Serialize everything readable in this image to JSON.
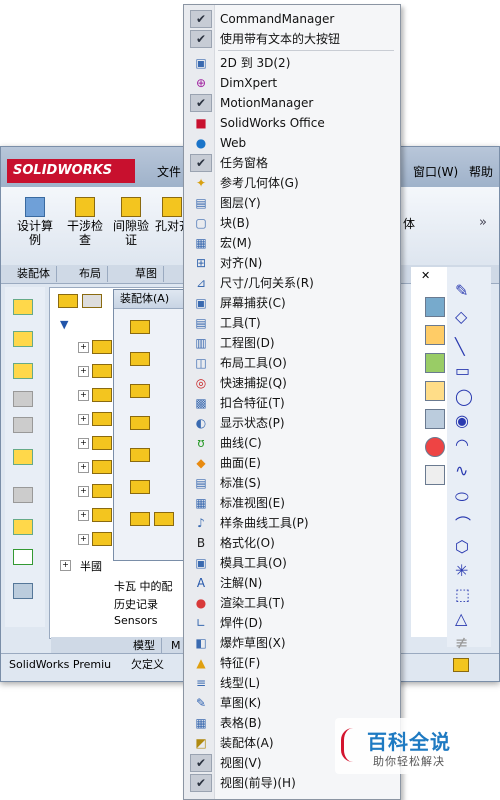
{
  "app": {
    "logo": "SOLIDWORKS",
    "menubar": [
      {
        "label": "文件"
      },
      {
        "label": "窗口(W)"
      },
      {
        "label": "帮助"
      }
    ],
    "ribbon": [
      {
        "label": "设计算\n例"
      },
      {
        "label": "干涉检\n查"
      },
      {
        "label": "间隙验\n证"
      },
      {
        "label": "孔对齐"
      },
      {
        "label": "体"
      }
    ],
    "tabs": [
      {
        "label": "装配体"
      },
      {
        "label": "布局"
      },
      {
        "label": "草图"
      }
    ],
    "popup_title": "装配体(A)",
    "tree": [
      {
        "label": "半國"
      },
      {
        "label": "卡瓦 中的配"
      },
      {
        "label": "历史记录"
      },
      {
        "label": "Sensors"
      }
    ],
    "bottom_tabs": [
      {
        "label": "模型"
      },
      {
        "label": "M"
      }
    ],
    "status_left": "SolidWorks Premiu",
    "status_mid": "欠定义"
  },
  "menu": {
    "items": [
      {
        "label": "CommandManager",
        "checked": true,
        "icon": "check-icon"
      },
      {
        "label": "使用带有文本的大按钮",
        "checked": true,
        "icon": "check-icon"
      },
      {
        "label": "2D 到 3D(2)",
        "checked": false,
        "icon": "2d-to-3d-icon"
      },
      {
        "label": "DimXpert",
        "checked": false,
        "icon": "dimxpert-icon"
      },
      {
        "label": "MotionManager",
        "checked": true,
        "icon": "check-icon"
      },
      {
        "label": "SolidWorks Office",
        "checked": false,
        "icon": "sw-office-icon"
      },
      {
        "label": "Web",
        "checked": false,
        "icon": "globe-icon"
      },
      {
        "label": "任务窗格",
        "checked": true,
        "icon": "check-icon"
      },
      {
        "label": "参考几何体(G)",
        "checked": false,
        "icon": "reference-geometry-icon"
      },
      {
        "label": "图层(Y)",
        "checked": false,
        "icon": "layer-icon"
      },
      {
        "label": "块(B)",
        "checked": false,
        "icon": "block-icon"
      },
      {
        "label": "宏(M)",
        "checked": false,
        "icon": "macro-icon"
      },
      {
        "label": "对齐(N)",
        "checked": false,
        "icon": "align-icon"
      },
      {
        "label": "尺寸/几何关系(R)",
        "checked": false,
        "icon": "dimension-icon"
      },
      {
        "label": "屏幕捕获(C)",
        "checked": false,
        "icon": "screen-capture-icon"
      },
      {
        "label": "工具(T)",
        "checked": false,
        "icon": "tools-icon"
      },
      {
        "label": "工程图(D)",
        "checked": false,
        "icon": "drawing-icon"
      },
      {
        "label": "布局工具(O)",
        "checked": false,
        "icon": "layout-tools-icon"
      },
      {
        "label": "快速捕捉(Q)",
        "checked": false,
        "icon": "quick-snap-icon"
      },
      {
        "label": "扣合特征(T)",
        "checked": false,
        "icon": "fastening-feature-icon"
      },
      {
        "label": "显示状态(P)",
        "checked": false,
        "icon": "display-state-icon"
      },
      {
        "label": "曲线(C)",
        "checked": false,
        "icon": "curve-icon"
      },
      {
        "label": "曲面(E)",
        "checked": false,
        "icon": "surface-icon"
      },
      {
        "label": "标准(S)",
        "checked": false,
        "icon": "standard-icon"
      },
      {
        "label": "标准视图(E)",
        "checked": false,
        "icon": "standard-views-icon"
      },
      {
        "label": "样条曲线工具(P)",
        "checked": false,
        "icon": "spline-tools-icon"
      },
      {
        "label": "格式化(O)",
        "checked": false,
        "icon": "format-icon"
      },
      {
        "label": "模具工具(O)",
        "checked": false,
        "icon": "mold-tools-icon"
      },
      {
        "label": "注解(N)",
        "checked": false,
        "icon": "annotation-icon"
      },
      {
        "label": "渲染工具(T)",
        "checked": false,
        "icon": "render-tools-icon"
      },
      {
        "label": "焊件(D)",
        "checked": false,
        "icon": "weldments-icon"
      },
      {
        "label": "爆炸草图(X)",
        "checked": false,
        "icon": "explode-sketch-icon"
      },
      {
        "label": "特征(F)",
        "checked": false,
        "icon": "features-icon"
      },
      {
        "label": "线型(L)",
        "checked": false,
        "icon": "line-format-icon"
      },
      {
        "label": "草图(K)",
        "checked": false,
        "icon": "sketch-icon"
      },
      {
        "label": "表格(B)",
        "checked": false,
        "icon": "table-icon"
      },
      {
        "label": "装配体(A)",
        "checked": false,
        "icon": "assembly-icon"
      },
      {
        "label": "视图(V)",
        "checked": true,
        "icon": "check-icon"
      },
      {
        "label": "视图(前导)(H)",
        "checked": true,
        "icon": "check-icon"
      }
    ]
  },
  "watermark": {
    "main": "百科全说",
    "sub": "助你轻松解决"
  },
  "colors": {
    "menu_bg": "#f5f6f8",
    "check_bg": "#c7ccd5",
    "brand_red": "#c8102e",
    "watermark_blue": "#1e7ac2"
  }
}
